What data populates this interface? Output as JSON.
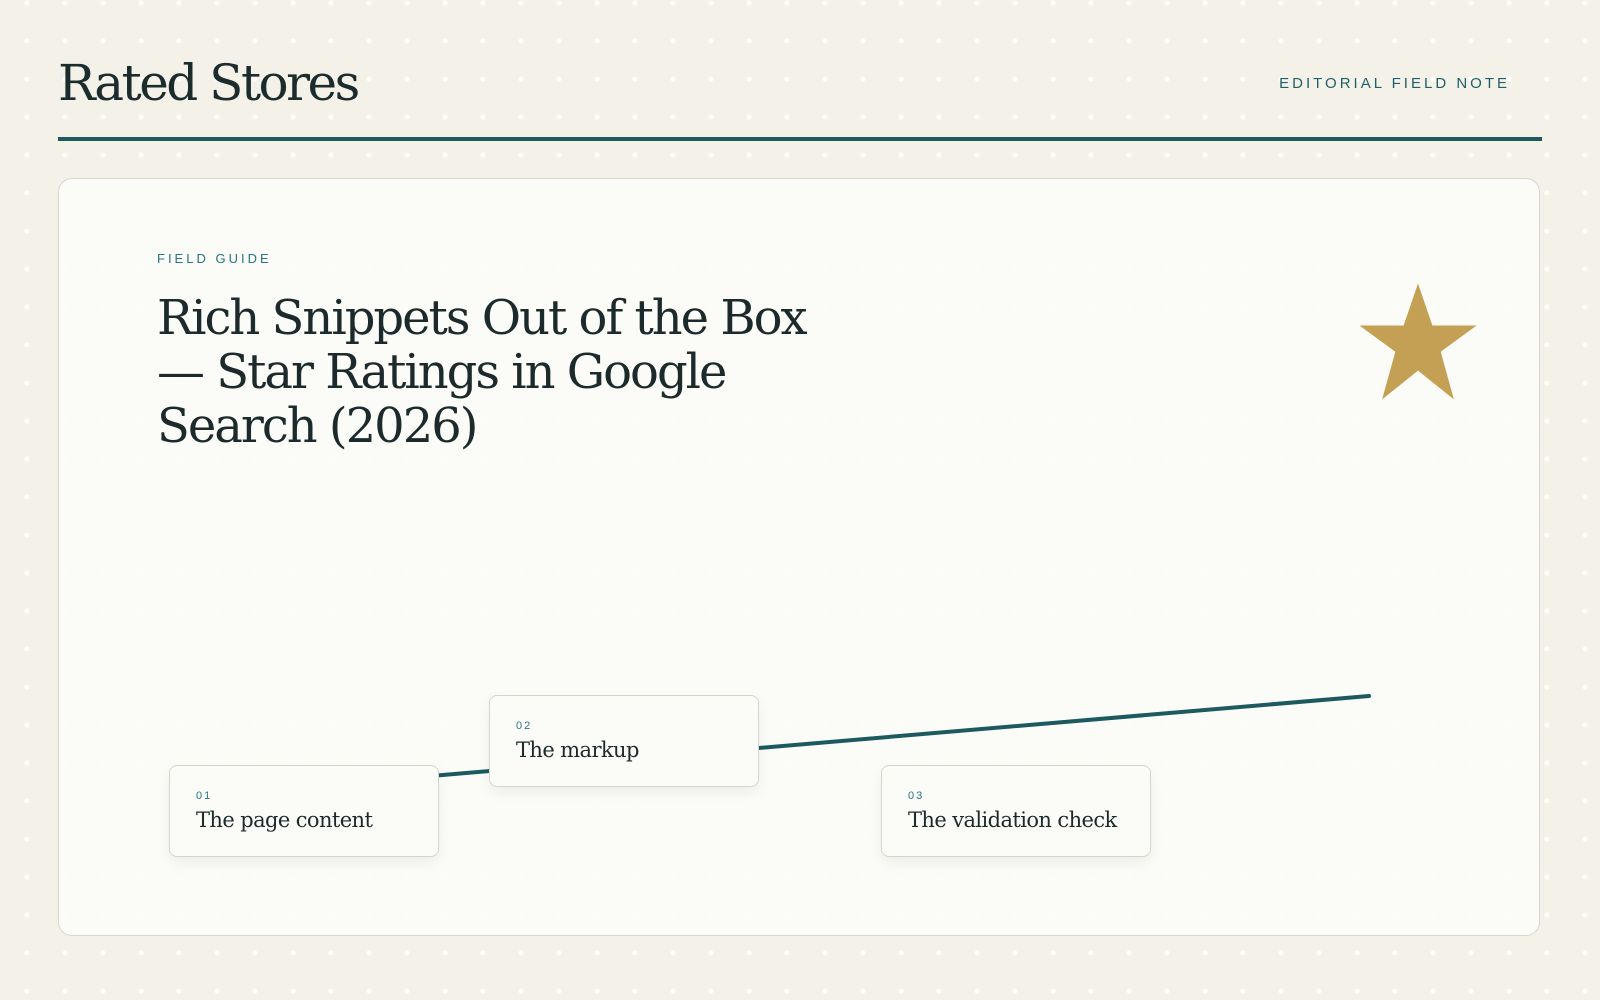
{
  "header": {
    "brand": "Rated Stores",
    "kicker": "EDITORIAL FIELD NOTE"
  },
  "hero": {
    "eyebrow": "FIELD GUIDE",
    "title": "Rich Snippets Out of the Box — Star Ratings in Google Search (2026)"
  },
  "steps": [
    {
      "number": "01",
      "title": "The page content"
    },
    {
      "number": "02",
      "title": "The markup"
    },
    {
      "number": "03",
      "title": "The validation check"
    }
  ],
  "icons": {
    "hero_icon": "star-icon"
  },
  "colors": {
    "accent": "#1c5a60",
    "star": "#c4a055",
    "label": "#2a7580"
  }
}
